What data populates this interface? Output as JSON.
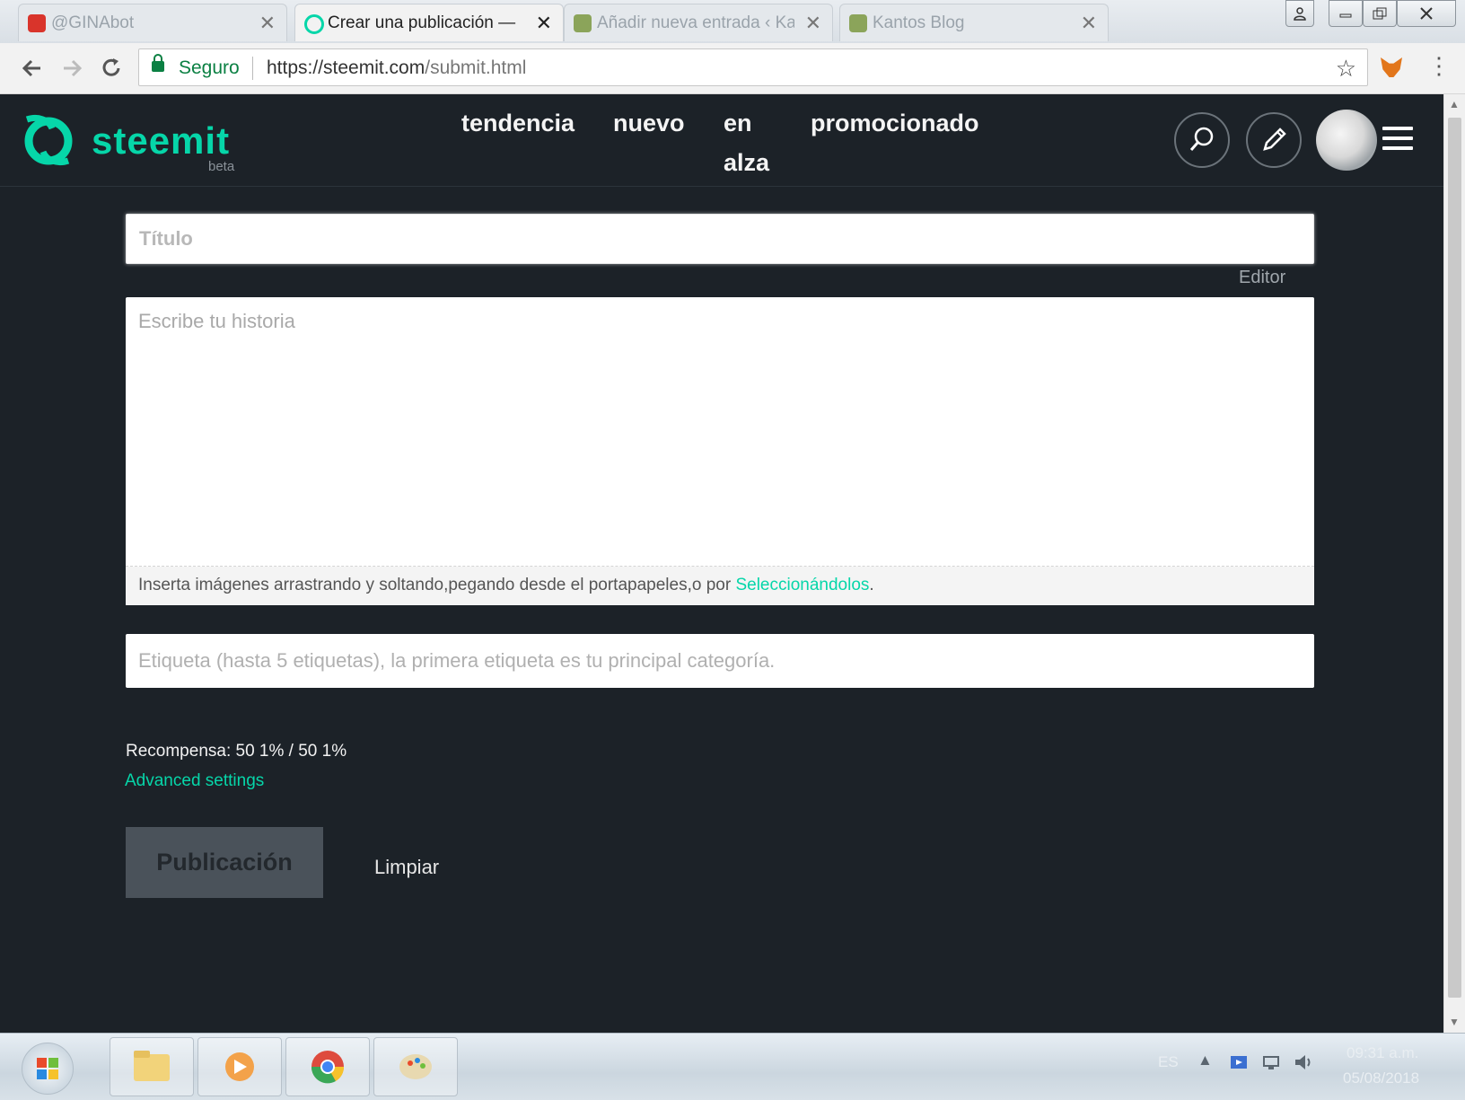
{
  "browser": {
    "tabs": [
      {
        "title": "@GINAbot",
        "active": false,
        "icon_color": "#d9342b"
      },
      {
        "title": "Crear una publicación —",
        "active": true,
        "icon_color": "#06d6a9"
      },
      {
        "title": "Añadir nueva entrada ‹ Ka",
        "active": false,
        "icon_color": "#8ba45a"
      },
      {
        "title": "Kantos Blog",
        "active": false,
        "icon_color": "#8ba45a"
      }
    ],
    "tab_close": "✕",
    "secure_label": "Seguro",
    "url_scheme_host": "https://steemit.com",
    "url_path": "/submit.html"
  },
  "header": {
    "logo_text": "steemit",
    "logo_badge": "beta",
    "nav": {
      "trending": "tendencia",
      "new": "nuevo",
      "hot_line1": "en",
      "hot_line2": "alza",
      "promoted": "promocionado"
    }
  },
  "form": {
    "title_placeholder": "Título",
    "editor_label": "Editor",
    "story_placeholder": "Escribe tu historia",
    "drop_hint": "Inserta imágenes arrastrando y soltando,pegando desde el portapapeles,o por ",
    "drop_link": "Seleccionándolos",
    "drop_end": ".",
    "tags_placeholder": "Etiqueta (hasta 5 etiquetas), la primera etiqueta es tu principal categoría.",
    "reward": "Recompensa: 50 1% / 50 1%",
    "advanced": "Advanced settings",
    "publish": "Publicación",
    "clear": "Limpiar"
  },
  "taskbar": {
    "lang": "ES",
    "time": "09:31 a.m.",
    "date": "05/08/2018"
  },
  "colors": {
    "accent": "#06d6a9",
    "background": "#1c2228"
  }
}
